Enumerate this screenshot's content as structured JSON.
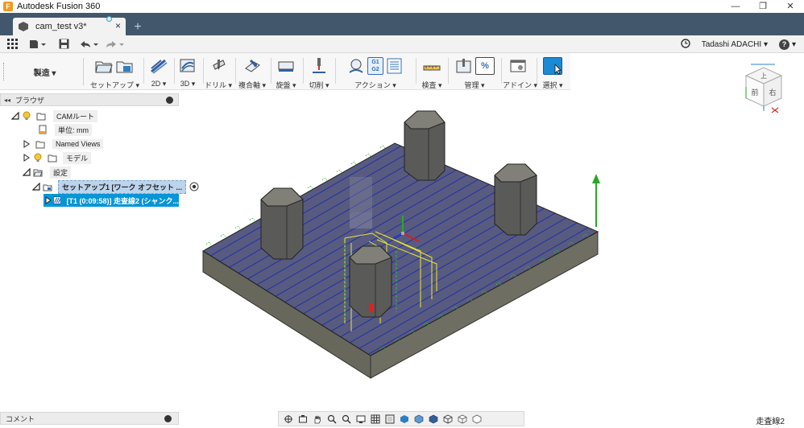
{
  "titlebar": {
    "app_logo": "F",
    "app_title": "Autodesk Fusion 360",
    "minimize": "—",
    "maximize": "❐",
    "close": "✕"
  },
  "tabs": {
    "document_title": "cam_test v3*",
    "close": "×",
    "new_tab": "+"
  },
  "qat": {
    "user_name": "Tadashi ADACHI ▾",
    "help": "?",
    "help_caret": "▾"
  },
  "ribbon": {
    "workspace": "製造 ▾",
    "groups": [
      {
        "label": "セットアップ ▾"
      },
      {
        "label": "2D ▾"
      },
      {
        "label": "3D ▾"
      },
      {
        "label": "ドリル ▾"
      },
      {
        "label": "複合軸 ▾"
      },
      {
        "label": "旋盤 ▾"
      },
      {
        "label": "切削 ▾"
      },
      {
        "label": "アクション ▾"
      },
      {
        "label": "検査 ▾"
      },
      {
        "label": "管理 ▾"
      },
      {
        "label": "アドイン ▾"
      },
      {
        "label": "選択 ▾"
      }
    ],
    "g1g2_top": "G1",
    "g1g2_bottom": "G2",
    "manage_percent": "%"
  },
  "viewcube": {
    "top": "上",
    "front": "前",
    "right": "右"
  },
  "browser": {
    "title": "ブラウザ",
    "collapse": "◂◂",
    "items": {
      "cam_root": "CAMルート",
      "units": "単位: mm",
      "named_views": "Named Views",
      "model": "モデル",
      "setups": "設定",
      "setup1": "セットアップ1 [ワーク オフセット ...",
      "operation1": "[T1 (0:09:58)] 走査線2 (シャンク..."
    }
  },
  "comments": {
    "label": "コメント"
  },
  "status": {
    "selected_operation": "走査線2"
  },
  "colors": {
    "tab_strip": "#42576b",
    "accent_blue": "#0696d7",
    "stock_top": "#5b5e86",
    "stock_side": "#6a6a5f",
    "boss": "#5a5a58",
    "toolpath_yellow": "#e8e832"
  }
}
